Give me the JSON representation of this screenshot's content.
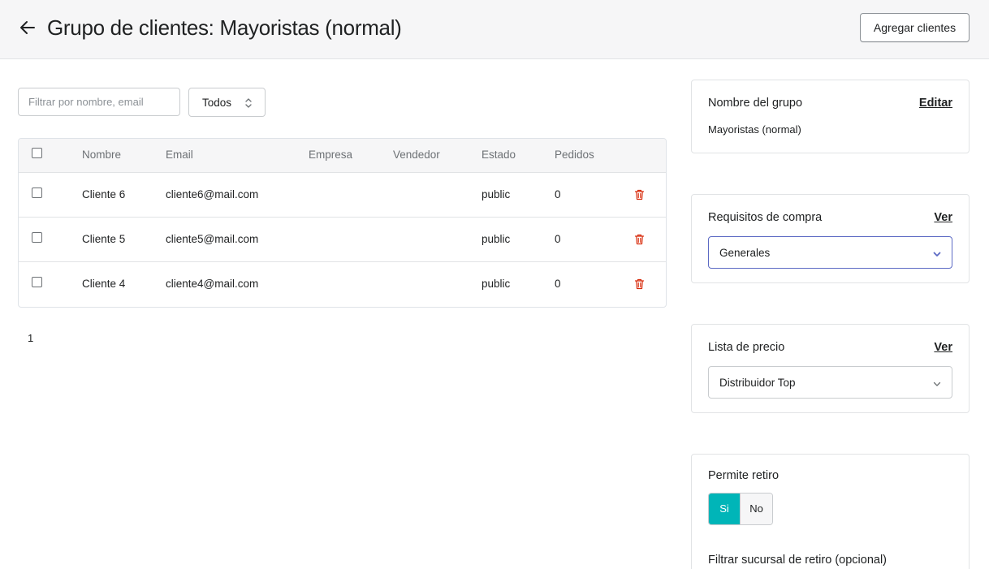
{
  "header": {
    "title": "Grupo de clientes: Mayoristas (normal)",
    "add_button": "Agregar clientes"
  },
  "filters": {
    "search_placeholder": "Filtrar por nombre, email",
    "status_select": "Todos"
  },
  "table": {
    "headers": {
      "nombre": "Nombre",
      "email": "Email",
      "empresa": "Empresa",
      "vendedor": "Vendedor",
      "estado": "Estado",
      "pedidos": "Pedidos"
    },
    "rows": [
      {
        "nombre": "Cliente 6",
        "email": "cliente6@mail.com",
        "empresa": "",
        "vendedor": "",
        "estado": "public",
        "pedidos": "0"
      },
      {
        "nombre": "Cliente 5",
        "email": "cliente5@mail.com",
        "empresa": "",
        "vendedor": "",
        "estado": "public",
        "pedidos": "0"
      },
      {
        "nombre": "Cliente 4",
        "email": "cliente4@mail.com",
        "empresa": "",
        "vendedor": "",
        "estado": "public",
        "pedidos": "0"
      }
    ]
  },
  "pagination": {
    "current_page": "1"
  },
  "sidebar": {
    "group_name": {
      "title": "Nombre del grupo",
      "action": "Editar",
      "value": "Mayoristas (normal)"
    },
    "purchase_requirements": {
      "title": "Requisitos de compra",
      "action": "Ver",
      "selected": "Generales"
    },
    "price_list": {
      "title": "Lista de precio",
      "action": "Ver",
      "selected": "Distribuidor Top"
    },
    "pickup": {
      "title": "Permite retiro",
      "yes": "Si",
      "no": "No",
      "selected": "Si",
      "branch_filter_label": "Filtrar sucursal de retiro (opcional)"
    }
  },
  "colors": {
    "accent": "#00b5b8",
    "focus_border": "#5c6ac4",
    "danger": "#d82c0d",
    "header_bg": "#f6f6f7"
  },
  "icons": {
    "back": "arrow-left-icon",
    "select_arrows": "updown-chevron-icon",
    "delete": "trash-icon",
    "dropdown": "chevron-down-icon"
  }
}
